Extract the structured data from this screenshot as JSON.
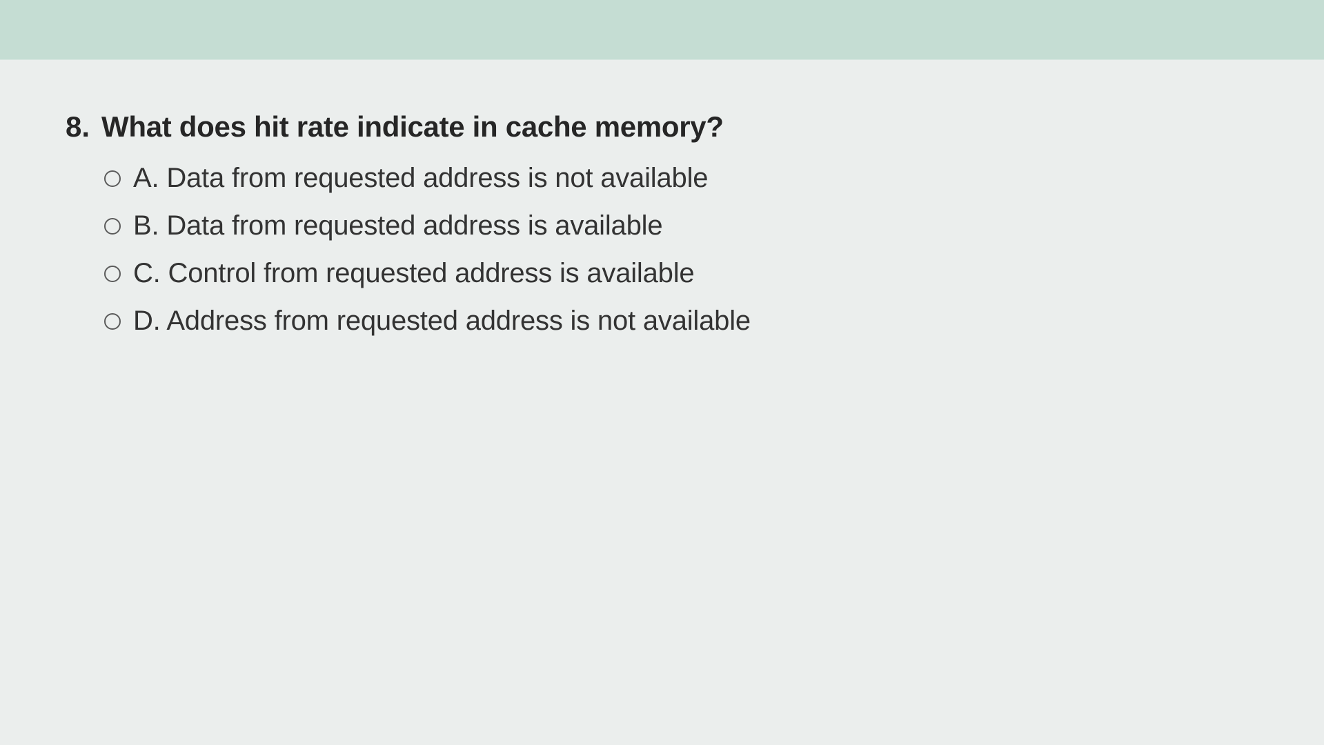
{
  "question": {
    "number": "8.",
    "text": "What does hit rate indicate in cache memory?",
    "options": [
      {
        "letter": "A.",
        "text": "Data from requested address is not available"
      },
      {
        "letter": "B.",
        "text": "Data from requested address is available"
      },
      {
        "letter": "C.",
        "text": "Control from requested address is available"
      },
      {
        "letter": "D.",
        "text": "Address from requested address is not available"
      }
    ]
  }
}
